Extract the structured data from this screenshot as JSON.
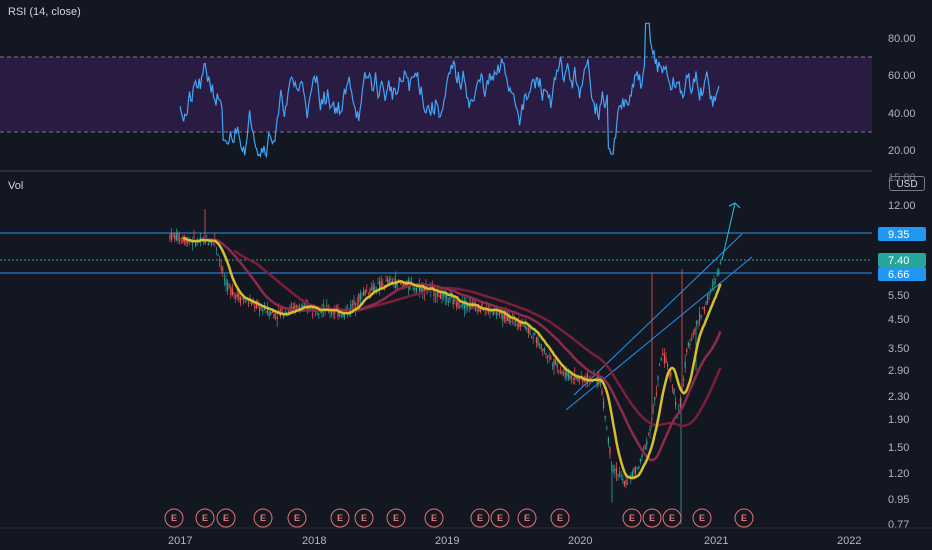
{
  "colors": {
    "background": "#131722",
    "rsi_line": "#42a5f5",
    "rsi_band": "#3c1f5c",
    "yellow_ma": "#d4c02e",
    "dark_ma": "#7a1f3a",
    "trendline": "#2196f3",
    "arrow": "#26c6da",
    "candle_up": "#26a69a",
    "candle_down": "#ef5350"
  },
  "rsi_pane": {
    "title": "RSI (14, close)",
    "axis_labels": [
      "80.00",
      "60.00",
      "40.00",
      "20.00",
      "15.00"
    ],
    "upper_band": 70,
    "lower_band": 30
  },
  "price_pane": {
    "title": "Vol",
    "currency_badge": "USD",
    "scale": "log",
    "axis_labels": [
      "12.00",
      "9.35",
      "7.40",
      "6.66",
      "5.50",
      "4.50",
      "3.50",
      "2.90",
      "2.30",
      "1.90",
      "1.50",
      "1.20",
      "0.95",
      "0.77"
    ],
    "price_tags": [
      {
        "label": "9.35",
        "value": 9.35,
        "color": "#2196f3"
      },
      {
        "label": "7.40",
        "value": 7.4,
        "color": "#26a69a"
      },
      {
        "label": "6.66",
        "value": 6.66,
        "color": "#2196f3"
      }
    ],
    "earnings_marker": "E",
    "earnings_count": 19
  },
  "time_axis": [
    "2017",
    "2018",
    "2019",
    "2020",
    "2021",
    "2022"
  ],
  "chart_data": {
    "type": "line",
    "x": [
      "2017",
      "2018",
      "2019",
      "2020",
      "2021",
      "2022"
    ],
    "ylim": [
      0.77,
      15.0
    ],
    "series": [
      {
        "values": [
          9.0,
          8.0,
          5.0,
          5.5,
          5.0,
          4.5,
          2.7,
          2.6,
          1.0,
          1.3,
          2.9,
          6.6,
          7.4
        ]
      }
    ],
    "horizontal_levels": [
      9.35,
      6.66
    ]
  }
}
